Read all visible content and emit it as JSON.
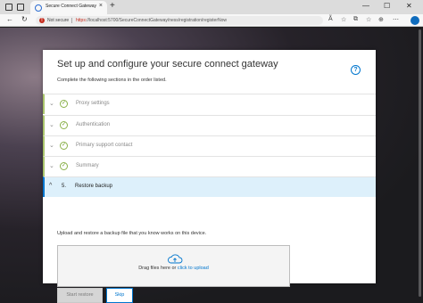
{
  "browser": {
    "tab_title": "Secure Connect Gateway",
    "tab_close": "×",
    "new_tab": "+",
    "not_secure": "Not secure",
    "url_scheme": "https:",
    "url_rest": "//localhost:5700/SecureConnectGateway/ness/registration/registerNow",
    "win_minimize": "—",
    "win_maximize": "☐",
    "win_close": "✕",
    "back": "←",
    "refresh": "↻",
    "tools": [
      "Ã",
      "☆",
      "⧉",
      "☆",
      "⊕",
      "⋯"
    ]
  },
  "card": {
    "title": "Set up and configure your secure connect gateway",
    "help": "?",
    "subtitle": "Complete the following sections in the order listed.",
    "steps": [
      {
        "label": "Proxy settings",
        "state": "complete"
      },
      {
        "label": "Authentication",
        "state": "complete"
      },
      {
        "label": "Primary support contact",
        "state": "complete"
      },
      {
        "label": "Summary",
        "state": "complete"
      }
    ],
    "active_step": {
      "number": "5.",
      "label": "Restore backup"
    },
    "chevron_down": "⌄",
    "chevron_up": "^",
    "check": "✓",
    "description": "Upload and restore a backup file that you know works on this device.",
    "drop_text": "Drag files here or ",
    "drop_link": "click to upload",
    "start_restore": "Start restore",
    "skip": "Skip"
  },
  "colors": {
    "accent": "#0076ce",
    "complete": "#8bb24a",
    "active_bg": "#ddf0fb",
    "warning": "#c42b1c"
  }
}
